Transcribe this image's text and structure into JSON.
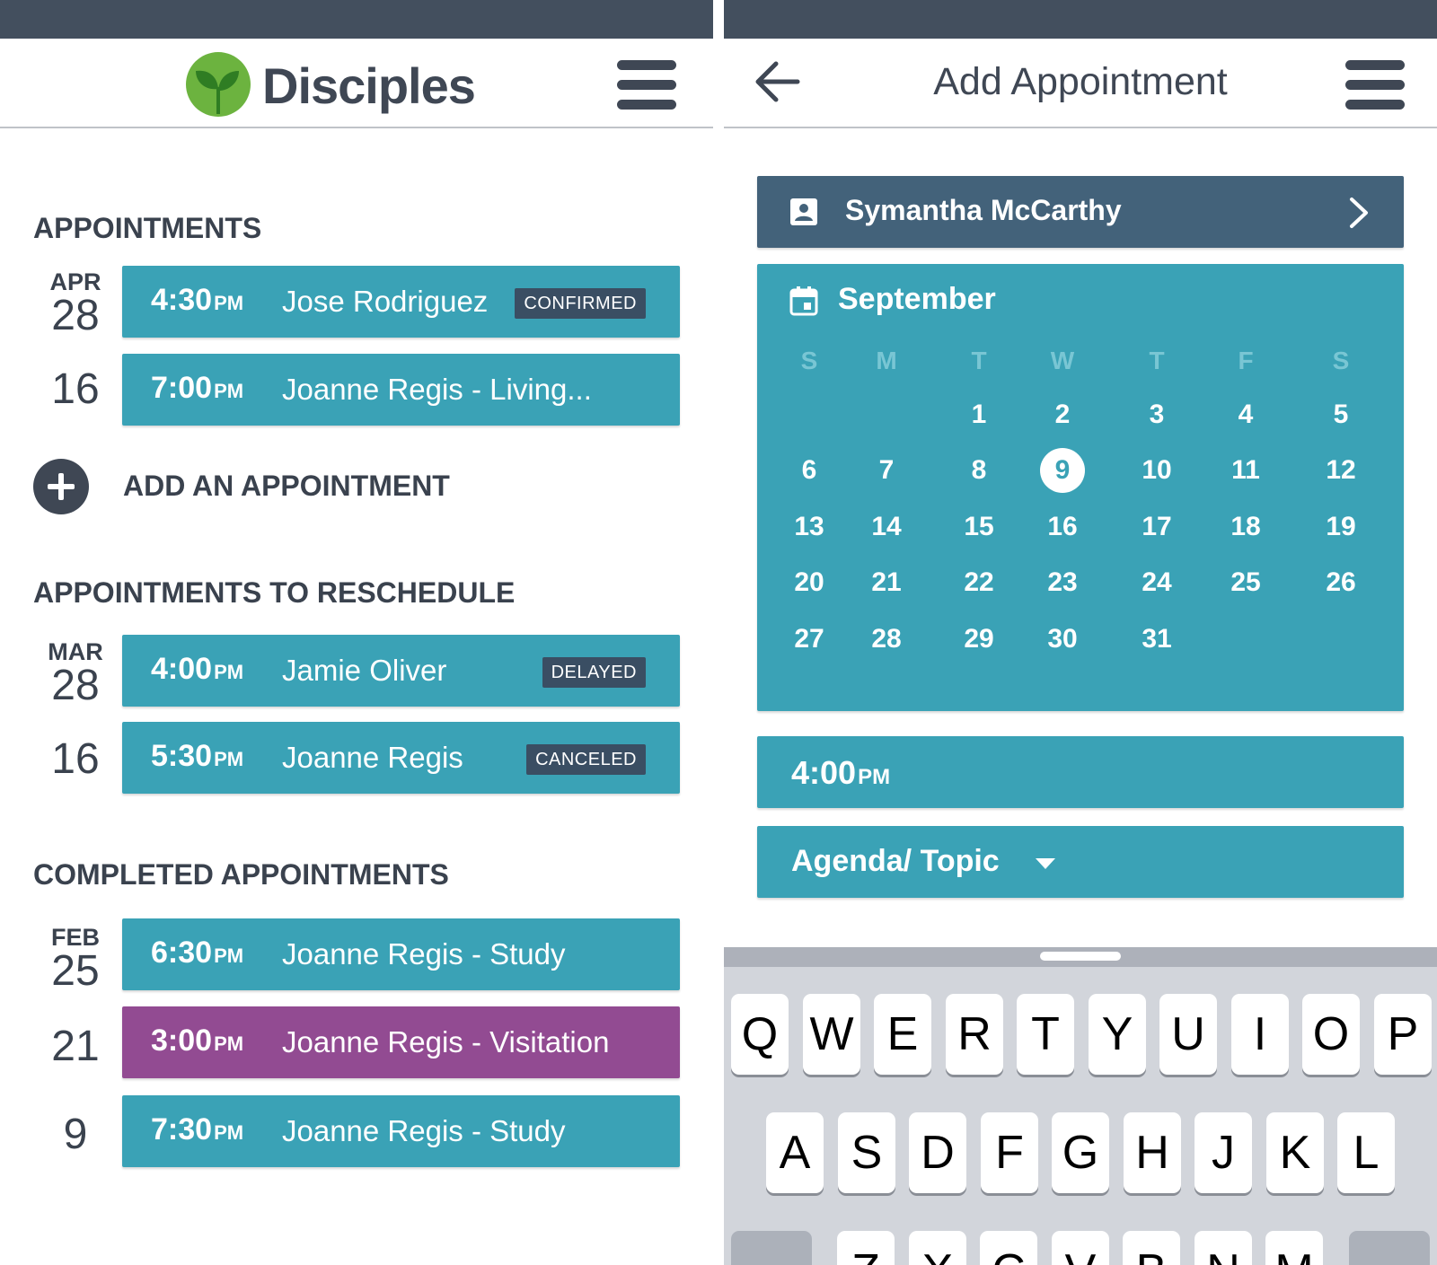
{
  "left_screen": {
    "brand": "Disciples",
    "sections": {
      "appointments": {
        "title": "APPOINTMENTS",
        "groups": [
          {
            "month": "APR",
            "day": "28",
            "item": {
              "time": "4:30",
              "ampm": "PM",
              "name": "Jose Rodriguez",
              "badge": "CONFIRMED"
            }
          },
          {
            "month": "",
            "day": "16",
            "item": {
              "time": "7:00",
              "ampm": "PM",
              "name": "Joanne Regis - Living...",
              "badge": ""
            }
          }
        ]
      },
      "add": {
        "label": "ADD AN APPOINTMENT"
      },
      "reschedule": {
        "title": "APPOINTMENTS TO RESCHEDULE",
        "groups": [
          {
            "month": "MAR",
            "day": "28",
            "item": {
              "time": "4:00",
              "ampm": "PM",
              "name": "Jamie Oliver",
              "badge": "DELAYED"
            }
          },
          {
            "month": "",
            "day": "16",
            "item": {
              "time": "5:30",
              "ampm": "PM",
              "name": "Joanne Regis",
              "badge": "CANCELED"
            }
          }
        ]
      },
      "completed": {
        "title": "COMPLETED APPOINTMENTS",
        "groups": [
          {
            "month": "FEB",
            "day": "25",
            "item": {
              "time": "6:30",
              "ampm": "PM",
              "name": "Joanne Regis - Study",
              "badge": ""
            }
          },
          {
            "month": "",
            "day": "21",
            "item": {
              "time": "3:00",
              "ampm": "PM",
              "name": "Joanne Regis - Visitation",
              "badge": ""
            }
          },
          {
            "month": "",
            "day": "9",
            "item": {
              "time": "7:30",
              "ampm": "PM",
              "name": "Joanne Regis - Study",
              "badge": ""
            }
          }
        ]
      }
    }
  },
  "right_screen": {
    "title": "Add Appointment",
    "contact": {
      "name": "Symantha McCarthy"
    },
    "calendar": {
      "month": "September",
      "weekdays": [
        "S",
        "M",
        "T",
        "W",
        "T",
        "F",
        "S"
      ],
      "weeks": [
        [
          "",
          "",
          "1",
          "2",
          "3",
          "4",
          "5"
        ],
        [
          "6",
          "7",
          "8",
          "9",
          "10",
          "11",
          "12"
        ],
        [
          "13",
          "14",
          "15",
          "16",
          "17",
          "18",
          "19"
        ],
        [
          "20",
          "21",
          "22",
          "23",
          "24",
          "25",
          "26"
        ],
        [
          "27",
          "28",
          "29",
          "30",
          "31",
          "",
          ""
        ]
      ],
      "selected_day": "9"
    },
    "time": {
      "value": "4:00",
      "ampm": "PM"
    },
    "agenda": {
      "label": "Agenda/ Topic"
    },
    "keyboard": {
      "row1": [
        "Q",
        "W",
        "E",
        "R",
        "T",
        "Y",
        "U",
        "I",
        "O",
        "P"
      ],
      "row2": [
        "A",
        "S",
        "D",
        "F",
        "G",
        "H",
        "J",
        "K",
        "L"
      ],
      "row3": [
        "Z",
        "X",
        "C",
        "V",
        "B",
        "N",
        "M"
      ]
    }
  },
  "colors": {
    "status_bar": "#434f5e",
    "teal": "#3aa2b6",
    "purple": "#924b92",
    "badge": "#3a4e63",
    "contact_bar": "#43627a",
    "text_dark": "#3a424e",
    "logo_green": "#6cb33f"
  },
  "icons": {
    "menu": "hamburger-menu-icon",
    "logo": "sprout-logo-icon",
    "add": "plus-circle-icon",
    "back": "arrow-left-icon",
    "contact": "contact-card-icon",
    "next": "chevron-right-icon",
    "calendar": "calendar-icon",
    "dropdown": "caret-down-icon"
  }
}
